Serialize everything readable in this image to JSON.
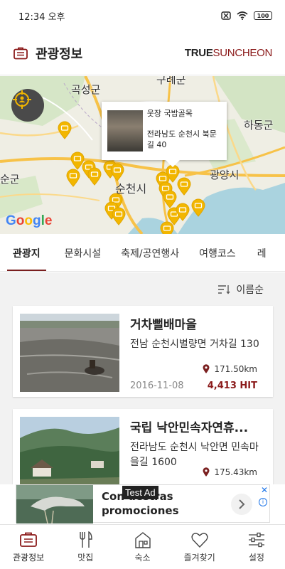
{
  "status_bar": {
    "time": "12:34 오후",
    "battery": "100"
  },
  "header": {
    "title": "관광정보",
    "logo_bold": "TRUE",
    "logo_accent": "SUNCHEON"
  },
  "map": {
    "labels": [
      "구례군",
      "곡성군",
      "하동군",
      "순천시",
      "광양시",
      "순군"
    ],
    "popup": {
      "name": "웃장 국밥골목",
      "address": "전라남도 순천시 북문길 40"
    },
    "attribution": "Google"
  },
  "tabs": [
    {
      "label": "관광지",
      "active": true
    },
    {
      "label": "문화시설",
      "active": false
    },
    {
      "label": "축제/공연행사",
      "active": false
    },
    {
      "label": "여행코스",
      "active": false
    },
    {
      "label": "레",
      "active": false
    }
  ],
  "sort": {
    "label": "이름순"
  },
  "cards": [
    {
      "name": "거차뻘배마을",
      "address": "전남 순천시별량면 거차길 130",
      "distance": "171.50km",
      "date": "2016-11-08",
      "hits": "4,413 HIT"
    },
    {
      "name": "국립 낙안민속자연휴...",
      "address": "전라남도 순천시 낙안면 민속마을길 1600",
      "distance": "175.43km",
      "date": "",
      "hits": ""
    }
  ],
  "ad": {
    "text": "Con  uestras promociones",
    "tag": "Test Ad",
    "close": "✕",
    "info": "i"
  },
  "bottom_nav": [
    {
      "label": "관광정보",
      "icon": "briefcase-icon",
      "active": true
    },
    {
      "label": "맛집",
      "icon": "fork-knife-icon",
      "active": false
    },
    {
      "label": "숙소",
      "icon": "house-icon",
      "active": false
    },
    {
      "label": "즐겨찾기",
      "icon": "heart-icon",
      "active": false
    },
    {
      "label": "설정",
      "icon": "sliders-icon",
      "active": false
    }
  ],
  "colors": {
    "accent": "#8b1a1a",
    "pin": "#f2b600"
  }
}
